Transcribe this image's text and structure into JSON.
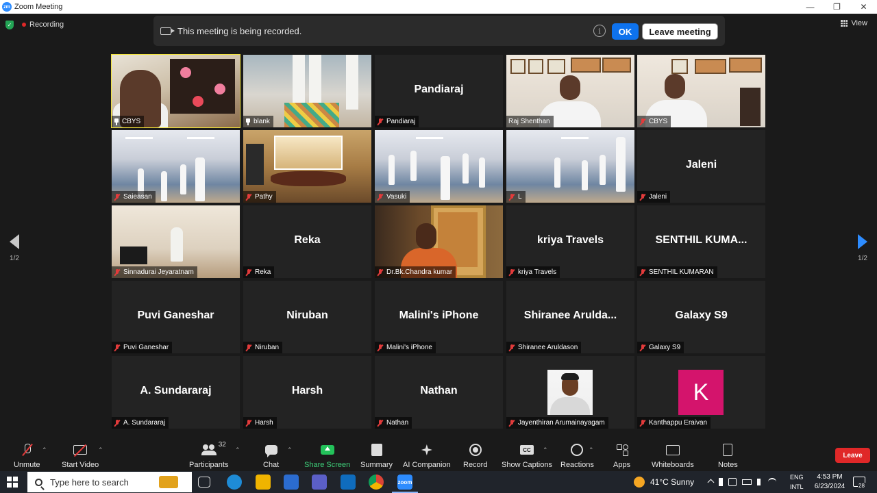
{
  "window": {
    "title": "Zoom Meeting",
    "logo": "zm",
    "controls": [
      "—",
      "❐",
      "✕"
    ]
  },
  "topbar": {
    "recording_label": "Recording",
    "view_label": "View"
  },
  "banner": {
    "message": "This meeting is being recorded.",
    "ok_label": "OK",
    "leave_label": "Leave meeting",
    "info_glyph": "i"
  },
  "pager": {
    "left": "1/2",
    "right": "1/2"
  },
  "tiles": [
    {
      "display": "",
      "tag": "CBYS",
      "video": "room1",
      "active": true,
      "pinned": true
    },
    {
      "display": "",
      "tag": "blank",
      "video": "blank",
      "pinned": true
    },
    {
      "display": "Pandiaraj",
      "tag": "Pandiaraj",
      "video": ""
    },
    {
      "display": "",
      "tag": "Raj Shenthan",
      "video": "office",
      "unmuted": true
    },
    {
      "display": "",
      "tag": "CBYS",
      "video": "office2"
    },
    {
      "display": "",
      "tag": "Saieasan",
      "video": "gym"
    },
    {
      "display": "",
      "tag": "Pathy",
      "video": "temple"
    },
    {
      "display": "",
      "tag": "Vasuki",
      "video": "gym2"
    },
    {
      "display": "",
      "tag": "L",
      "video": "gym3"
    },
    {
      "display": "Jaleni",
      "tag": "Jaleni",
      "video": ""
    },
    {
      "display": "",
      "tag": "Sinnadurai Jeyaratnam",
      "video": "home"
    },
    {
      "display": "Reka",
      "tag": "Reka",
      "video": ""
    },
    {
      "display": "",
      "tag": "Dr.Bk.Chandra kumar",
      "video": "dr"
    },
    {
      "display": "kriya Travels",
      "tag": "kriya Travels",
      "video": ""
    },
    {
      "display": "SENTHIL KUMA...",
      "tag": "SENTHIL KUMARAN",
      "video": ""
    },
    {
      "display": "Puvi Ganeshar",
      "tag": "Puvi Ganeshar",
      "video": ""
    },
    {
      "display": "Niruban",
      "tag": "Niruban",
      "video": ""
    },
    {
      "display": "Malini's iPhone",
      "tag": "Malini's iPhone",
      "video": ""
    },
    {
      "display": "Shiranee  Arulda...",
      "tag": "Shiranee Aruldason",
      "video": ""
    },
    {
      "display": "Galaxy S9",
      "tag": "Galaxy S9",
      "video": ""
    },
    {
      "display": "A. Sundararaj",
      "tag": "A. Sundararaj",
      "video": ""
    },
    {
      "display": "Harsh",
      "tag": "Harsh",
      "video": ""
    },
    {
      "display": "Nathan",
      "tag": "Nathan",
      "video": ""
    },
    {
      "display": "",
      "tag": "Jayenthiran Arumainayagam",
      "video": "photo"
    },
    {
      "display": "",
      "tag": "Kanthappu Eraivan",
      "video": "letter",
      "letter": "K"
    }
  ],
  "toolbar": {
    "unmute": "Unmute",
    "start_video": "Start Video",
    "participants": "Participants",
    "participants_count": "32",
    "chat": "Chat",
    "share_screen": "Share Screen",
    "summary": "Summary",
    "ai_companion": "AI Companion",
    "record": "Record",
    "show_captions": "Show Captions",
    "captions_glyph": "CC",
    "reactions": "Reactions",
    "apps": "Apps",
    "whiteboards": "Whiteboards",
    "notes": "Notes",
    "leave": "Leave"
  },
  "taskbar": {
    "search_placeholder": "Type here to search",
    "weather": "41°C  Sunny",
    "lang_top": "ENG",
    "lang_bottom": "INTL",
    "time": "4:53 PM",
    "date": "6/23/2024",
    "notifications": "28",
    "zoom_glyph": "zoom"
  },
  "colors": {
    "accent": "#0e72ed",
    "leave": "#e02828",
    "active_speaker": "#f2e33a",
    "share": "#23c25a"
  }
}
